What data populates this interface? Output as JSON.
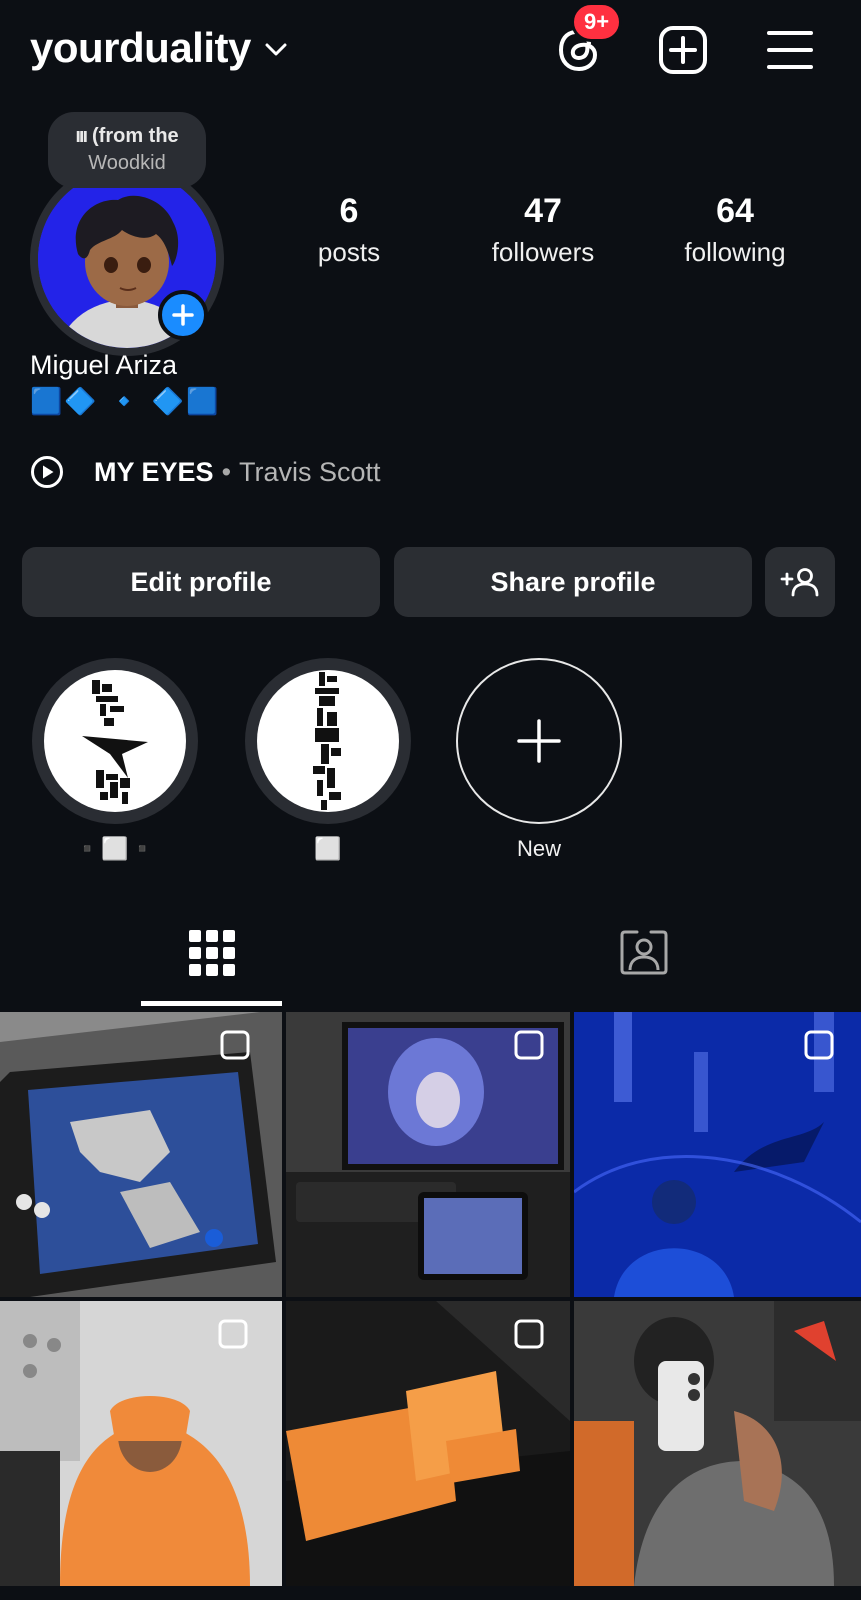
{
  "header": {
    "username": "yourduality",
    "notification_badge": "9+",
    "icons": [
      "chevron-down-icon",
      "threads-icon",
      "create-post-icon",
      "menu-icon"
    ]
  },
  "note": {
    "line1": "(from the",
    "line2": "Woodkid"
  },
  "profile": {
    "name": "Miguel Ariza",
    "bio": "🟦🔷 🔹 🔷🟦",
    "stats": [
      {
        "value": "6",
        "label": "posts"
      },
      {
        "value": "47",
        "label": "followers"
      },
      {
        "value": "64",
        "label": "following"
      }
    ],
    "music": {
      "song": "MY EYES",
      "separator": "•",
      "artist": "Travis Scott"
    }
  },
  "buttons": {
    "edit": "Edit profile",
    "share": "Share profile"
  },
  "highlights": [
    {
      "label": "▪️⬜▪️"
    },
    {
      "label": "⬜"
    },
    {
      "label": "New"
    }
  ],
  "colors": {
    "background": "#0c0f14",
    "button": "#2b2e33",
    "accent_blue": "#1a8cff",
    "badge_red": "#ff3040"
  }
}
